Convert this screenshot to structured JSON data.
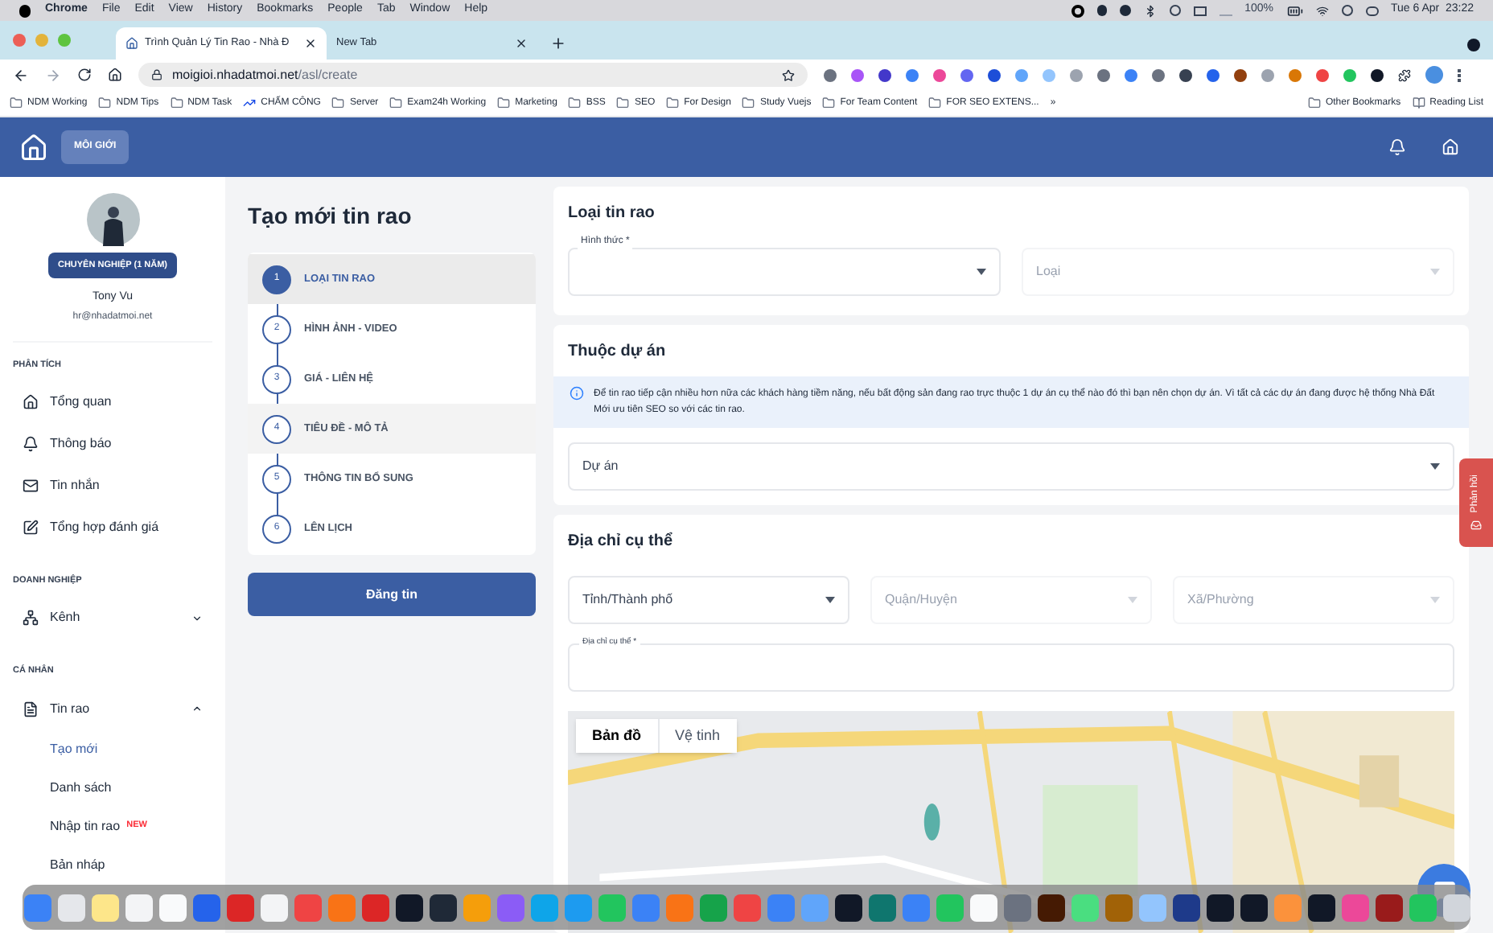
{
  "menubar": {
    "app": "Chrome",
    "menus": [
      "File",
      "Edit",
      "View",
      "History",
      "Bookmarks",
      "People",
      "Tab",
      "Window",
      "Help"
    ],
    "battery": "100%",
    "datetime": "Tue 6 Apr  23:22"
  },
  "tabs": [
    {
      "title": "Trình Quản Lý Tin Rao - Nhà Đ",
      "selected": true
    },
    {
      "title": "New Tab",
      "selected": false
    }
  ],
  "address": {
    "host": "moigioi.nhadatmoi.net",
    "path": "/asl/create"
  },
  "bookmarks": [
    {
      "label": "NDM Working",
      "kind": "folder"
    },
    {
      "label": "NDM Tips",
      "kind": "folder"
    },
    {
      "label": "NDM Task",
      "kind": "folder"
    },
    {
      "label": "CHẤM CÔNG",
      "kind": "link"
    },
    {
      "label": "Server",
      "kind": "folder"
    },
    {
      "label": "Exam24h Working",
      "kind": "folder"
    },
    {
      "label": "Marketing",
      "kind": "folder"
    },
    {
      "label": "BSS",
      "kind": "folder"
    },
    {
      "label": "SEO",
      "kind": "folder"
    },
    {
      "label": "For Design",
      "kind": "folder"
    },
    {
      "label": "Study Vuejs",
      "kind": "folder"
    },
    {
      "label": "For Team Content",
      "kind": "folder"
    },
    {
      "label": "FOR SEO EXTENS...",
      "kind": "folder"
    }
  ],
  "bookmarks_more": "»",
  "bookmarks_right": [
    {
      "label": "Other Bookmarks",
      "kind": "folder"
    },
    {
      "label": "Reading List",
      "kind": "list"
    }
  ],
  "app_header": {
    "badge": "MÔI GIỚI"
  },
  "profile": {
    "badge": "CHUYÊN NGHIỆP (1 NĂM)",
    "name": "Tony Vu",
    "email": "hr@nhadatmoi.net"
  },
  "nav": [
    {
      "title": "PHÂN TÍCH",
      "items": [
        {
          "label": "Tổng quan"
        },
        {
          "label": "Thông báo"
        },
        {
          "label": "Tin nhắn"
        },
        {
          "label": "Tổng hợp đánh giá"
        }
      ]
    },
    {
      "title": "DOANH NGHIỆP",
      "items": [
        {
          "label": "Kênh",
          "expanded": false
        }
      ]
    },
    {
      "title": "CÁ NHÂN",
      "items": [
        {
          "label": "Tin rao",
          "expanded": true,
          "children": [
            {
              "label": "Tạo mới",
              "selected": true
            },
            {
              "label": "Danh sách",
              "selected": false
            },
            {
              "label": "Nhập tin rao",
              "selected": false,
              "tag": "NEW"
            },
            {
              "label": "Bản nháp",
              "selected": false
            }
          ]
        }
      ]
    }
  ],
  "page_title": "Tạo mới tin rao",
  "steps": [
    {
      "number": "1",
      "label": "LOẠI TIN RAO",
      "selected": true,
      "hovered": false
    },
    {
      "number": "2",
      "label": "HÌNH ẢNH - VIDEO",
      "selected": false,
      "hovered": false
    },
    {
      "number": "3",
      "label": "GIÁ - LIÊN HỆ",
      "selected": false,
      "hovered": false
    },
    {
      "number": "4",
      "label": "TIÊU ĐỀ - MÔ TẢ",
      "selected": false,
      "hovered": true
    },
    {
      "number": "5",
      "label": "THÔNG TIN BỔ SUNG",
      "selected": false,
      "hovered": false
    },
    {
      "number": "6",
      "label": "LÊN LỊCH",
      "selected": false,
      "hovered": false
    }
  ],
  "submit": "Đăng tin",
  "listing_type": {
    "title": "Loại tin rao",
    "fields": [
      {
        "label": "Hình thức *",
        "disabled": false
      },
      {
        "placeholder": "Loại",
        "disabled": true
      }
    ]
  },
  "project": {
    "title": "Thuộc dự án",
    "info": "Để tin rao tiếp cận nhiều hơn nữa các khách hàng tiềm năng, nếu bất động sản đang rao trực thuộc 1 dự án cụ thể nào đó thì bạn nên chọn dự án. Vì tất cả các dự án đang được hệ thống Nhà Đất Mới ưu tiên SEO so với các tin rao.",
    "field": {
      "placeholder": "Dự án",
      "disabled": false
    }
  },
  "address_section": {
    "title": "Địa chỉ cụ thể",
    "selects": [
      {
        "placeholder": "Tỉnh/Thành phố",
        "disabled": false
      },
      {
        "placeholder": "Quận/Huyện",
        "disabled": true
      },
      {
        "placeholder": "Xã/Phường",
        "disabled": true
      }
    ],
    "detail_label": "Địa chỉ cụ thể *",
    "map_types": [
      {
        "label": "Bản đồ",
        "selected": true
      },
      {
        "label": "Vệ tinh",
        "selected": false
      }
    ]
  },
  "feedback": "Phản hồi"
}
